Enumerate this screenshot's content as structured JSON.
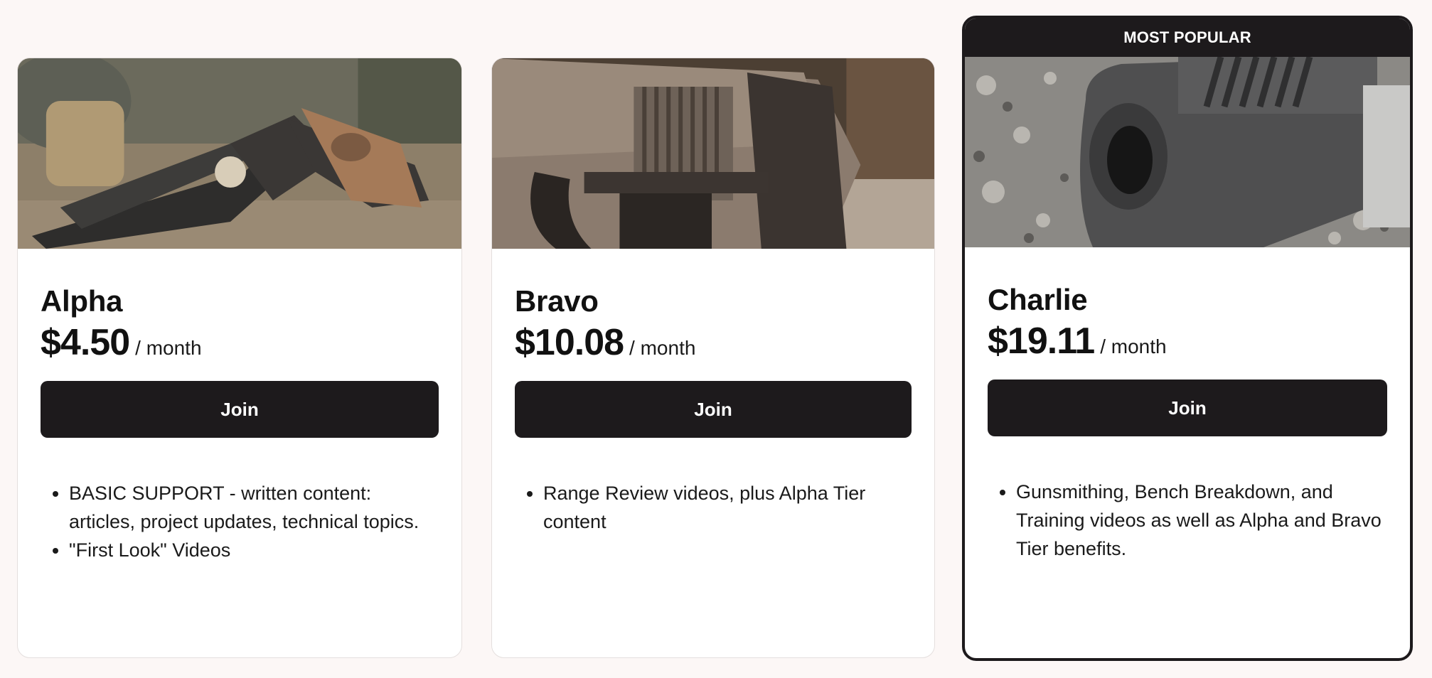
{
  "tiers": [
    {
      "name": "Alpha",
      "price": "$4.50",
      "period": "/ month",
      "button": "Join",
      "benefits": [
        "BASIC SUPPORT - written content: articles, project updates, technical topics.",
        "\"First Look\" Videos"
      ]
    },
    {
      "name": "Bravo",
      "price": "$10.08",
      "period": "/ month",
      "button": "Join",
      "benefits": [
        "Range Review videos, plus Alpha Tier content"
      ]
    },
    {
      "name": "Charlie",
      "badge": "MOST POPULAR",
      "price": "$19.11",
      "period": "/ month",
      "button": "Join",
      "benefits": [
        "Gunsmithing, Bench Breakdown, and Training videos as well as Alpha and Bravo Tier benefits."
      ]
    }
  ],
  "colors": {
    "page_background": "#fcf7f6",
    "button": "#1d1a1c",
    "card": "#ffffff"
  }
}
